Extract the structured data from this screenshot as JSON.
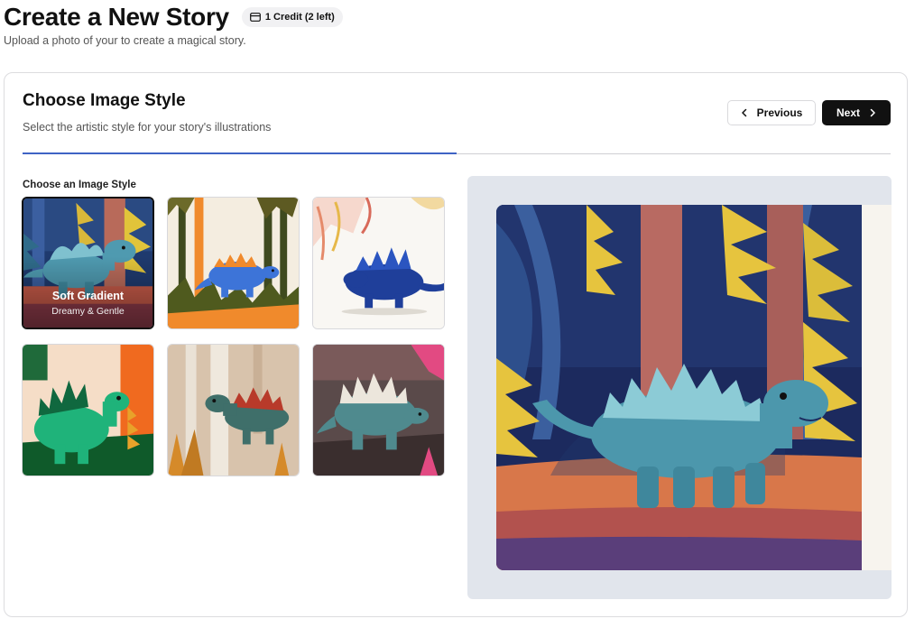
{
  "header": {
    "title": "Create a New Story",
    "credit_badge": "1 Credit (2 left)",
    "subtitle": "Upload a photo of your to create a magical story."
  },
  "step": {
    "title": "Choose Image Style",
    "subtitle": "Select the artistic style for your story's illustrations",
    "progress_fraction": 0.5
  },
  "nav": {
    "previous_label": "Previous",
    "next_label": "Next"
  },
  "styles": {
    "section_label": "Choose an Image Style",
    "selected_index": 0,
    "items": [
      {
        "name": "Soft Gradient",
        "description": "Dreamy & Gentle"
      }
    ]
  },
  "colors": {
    "accent": "#3f63c4",
    "primary_button": "#111111",
    "preview_background": "#e1e5ec"
  }
}
